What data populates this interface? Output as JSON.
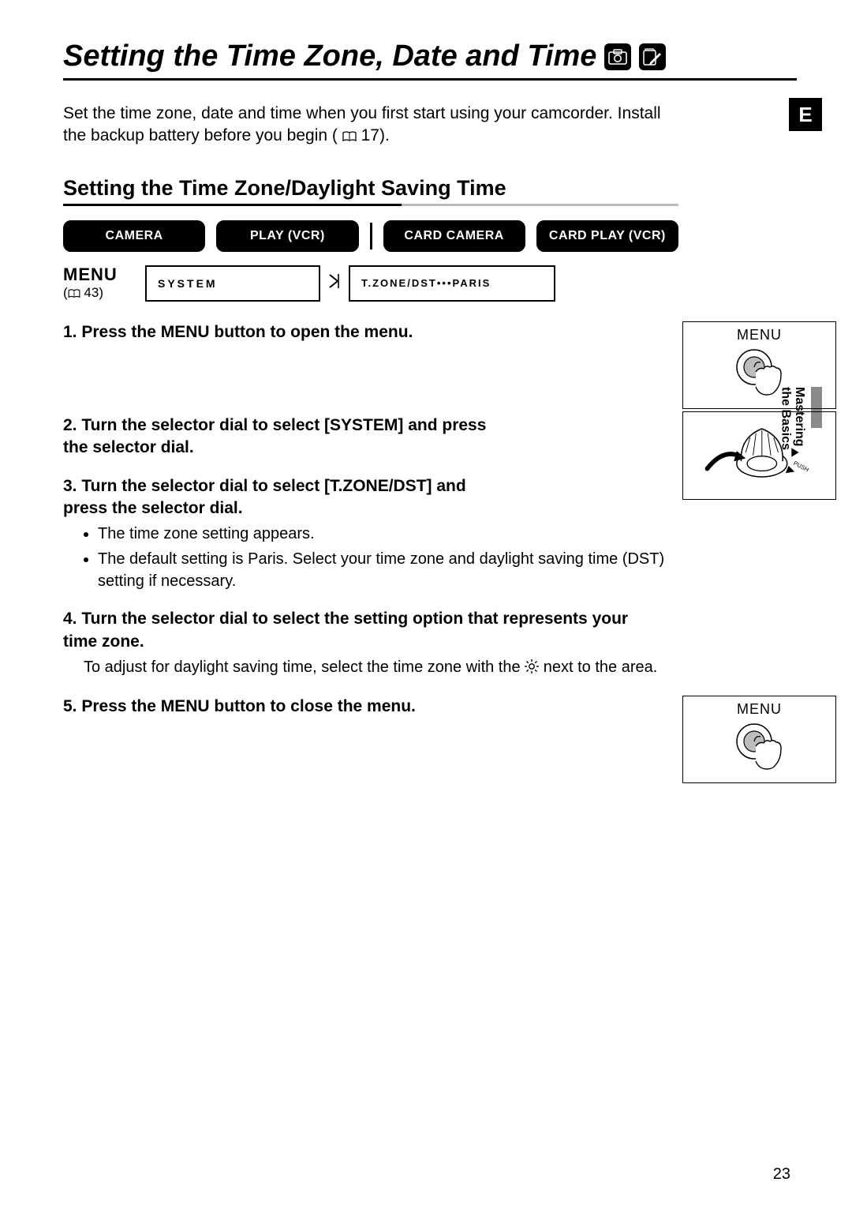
{
  "page_number": "23",
  "language_tab": "E",
  "side_tab_line1": "Mastering",
  "side_tab_line2": "the Basics",
  "title": "Setting the Time Zone, Date and Time",
  "title_icon1": "card-in-camera-icon",
  "title_icon2": "card-write-icon",
  "intro": {
    "text_a": "Set the time zone, date and time when you first start using your camcorder. Install the backup battery before you begin (",
    "ref": "17",
    "text_b": ")."
  },
  "subhead": "Setting the Time Zone/Daylight Saving Time",
  "modes": [
    "CAMERA",
    "PLAY (VCR)",
    "CARD CAMERA",
    "CARD PLAY (VCR)"
  ],
  "menu": {
    "label": "MENU",
    "ref": "43",
    "box1": "SYSTEM",
    "box2": "T.ZONE/DST•••PARIS"
  },
  "steps": {
    "s1": {
      "heading": "1. Press the MENU button to open the menu.",
      "illus_label": "MENU"
    },
    "s2": {
      "heading": "2. Turn the selector dial to select [SYSTEM] and press the selector dial."
    },
    "s3": {
      "heading": "3. Turn the selector dial to select [T.ZONE/DST] and press the selector dial.",
      "bullets": [
        "The time zone setting appears.",
        "The default setting is Paris. Select your time zone and daylight saving time (DST) setting if necessary."
      ]
    },
    "s4": {
      "heading": "4. Turn the selector dial to select the setting option that represents your time zone.",
      "body_a": "To adjust for daylight saving time, select the time zone with the ",
      "body_b": " next to the area."
    },
    "s5": {
      "heading": "5. Press the MENU button to close the menu.",
      "illus_label": "MENU"
    }
  }
}
